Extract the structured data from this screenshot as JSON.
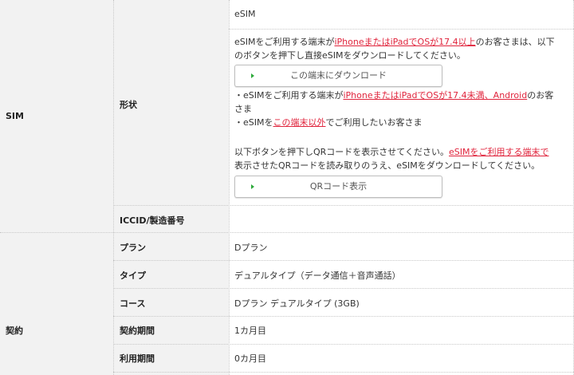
{
  "sim": {
    "section_label": "SIM",
    "shape_label": "形状",
    "shape_value": "eSIM",
    "para1": {
      "pre": "eSIMをご利用する端末が",
      "link": "iPhoneまたはiPadでOSが17.4以上",
      "post1": "のお客さまは、以下",
      "line2": "のボタンを押下し直接eSIMをダウンロードしてください。"
    },
    "download_button": "この端末にダウンロード",
    "bullet1": {
      "pre": "・eSIMをご利用する端末が",
      "link": "iPhoneまたはiPadでOSが17.4未満、Android",
      "post": "のお客",
      "line2": "さま"
    },
    "bullet2": {
      "pre": "・eSIMを",
      "link": "この端末以外",
      "post": "でご利用したいお客さま"
    },
    "para2": {
      "pre": "以下ボタンを押下しQRコードを表示させてください。",
      "link": "eSIMをご利用する端末で",
      "line2": "表示させたQRコードを読み取りのうえ、eSIMをダウンロードしてください。"
    },
    "qr_button": "QRコード表示",
    "iccid_label": "ICCID/製造番号",
    "iccid_value": ""
  },
  "contract": {
    "section_label": "契約",
    "rows": [
      {
        "label": "プラン",
        "value": "Dプラン"
      },
      {
        "label": "タイプ",
        "value": "デュアルタイプ（データ通信＋音声通話）"
      },
      {
        "label": "コース",
        "value": "Dプラン デュアルタイプ (3GB)"
      },
      {
        "label": "契約期間",
        "value": "1カ月目"
      },
      {
        "label": "利用期間",
        "value": "0カ月目"
      }
    ]
  },
  "colors": {
    "accent_red": "#e0243c",
    "arrow_green": "#2eaa3c",
    "header_bg": "#f2f2f2"
  }
}
